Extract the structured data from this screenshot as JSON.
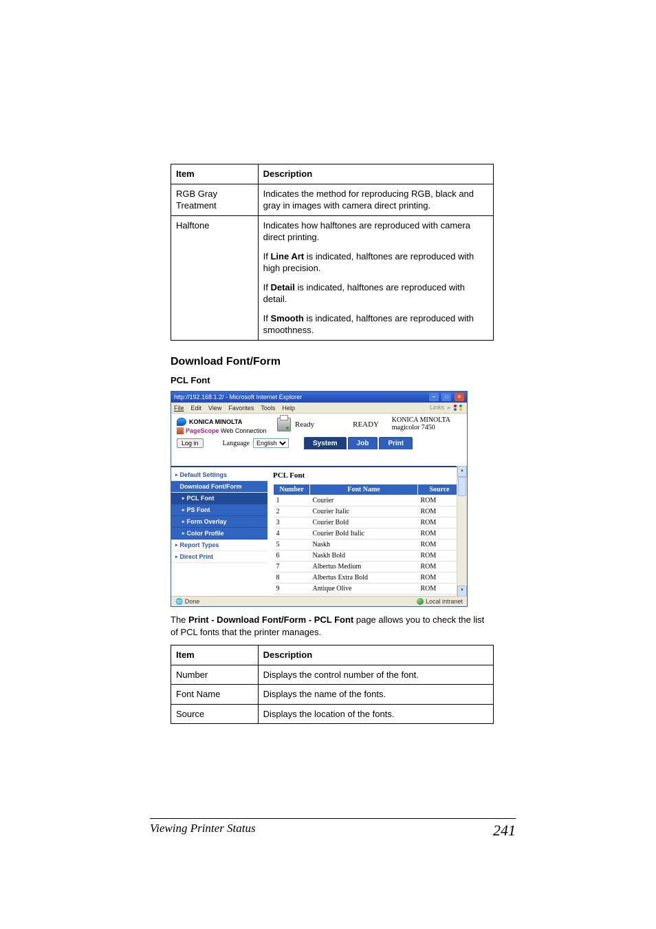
{
  "tables": {
    "top": {
      "head_item": "Item",
      "head_desc": "Description",
      "rows": [
        {
          "item": "RGB Gray Treatment",
          "desc": [
            "Indicates the method for reproducing RGB, black and gray in images with camera direct printing."
          ]
        },
        {
          "item": "Halftone",
          "desc": [
            "Indicates how halftones are reproduced with camera direct printing.",
            {
              "pre": "If ",
              "bold": "Line Art",
              "post": " is indicated, halftones are reproduced with high precision."
            },
            {
              "pre": "If ",
              "bold": "Detail",
              "post": " is indicated, halftones are reproduced with detail."
            },
            {
              "pre": "If ",
              "bold": "Smooth",
              "post": " is indicated, halftones are reproduced with smoothness."
            }
          ]
        }
      ]
    },
    "bottom": {
      "head_item": "Item",
      "head_desc": "Description",
      "rows": [
        {
          "item": "Number",
          "desc": "Displays the control number of the font."
        },
        {
          "item": "Font Name",
          "desc": "Displays the name of the fonts."
        },
        {
          "item": "Source",
          "desc": "Displays the location of the fonts."
        }
      ]
    }
  },
  "section": {
    "heading": "Download Font/Form",
    "sub": "PCL Font",
    "intro_pre": "The ",
    "intro_bold": "Print - Download Font/Form - PCL Font",
    "intro_post": " page allows you to check the list of PCL fonts that the printer manages."
  },
  "screenshot": {
    "title": "http://192.168.1.2/ - Microsoft Internet Explorer",
    "menu": [
      "File",
      "Edit",
      "View",
      "Favorites",
      "Tools",
      "Help"
    ],
    "links_label": "Links",
    "brand": "KONICA MINOLTA",
    "web_conn_pre": "PageScope",
    "web_conn": "Web Connection",
    "printer_ready": "Ready",
    "ready_big": "READY",
    "model1": "KONICA MINOLTA",
    "model2": "magicolor 7450",
    "login_btn": "Log in",
    "lang_label": "Language",
    "lang_value": "English",
    "tabs": [
      "System",
      "Job",
      "Print"
    ],
    "sidebar": {
      "default_settings": "Default Settings",
      "download": "Download Font/Form",
      "pcl": "PCL Font",
      "ps": "PS Font",
      "overlay": "Form Overlay",
      "color_profile": "Color Profile",
      "report": "Report Types",
      "direct": "Direct Print"
    },
    "pane_title": "PCL Font",
    "font_table": {
      "headers": [
        "Number",
        "Font Name",
        "Source"
      ],
      "rows": [
        [
          "1",
          "Courier",
          "ROM"
        ],
        [
          "2",
          "Courier Italic",
          "ROM"
        ],
        [
          "3",
          "Courier Bold",
          "ROM"
        ],
        [
          "4",
          "Courier Bold Italic",
          "ROM"
        ],
        [
          "5",
          "Naskh",
          "ROM"
        ],
        [
          "6",
          "Naskh Bold",
          "ROM"
        ],
        [
          "7",
          "Albertus Medium",
          "ROM"
        ],
        [
          "8",
          "Albertus Extra Bold",
          "ROM"
        ],
        [
          "9",
          "Antique Olive",
          "ROM"
        ]
      ]
    },
    "status_done": "Done",
    "status_zone": "Local intranet"
  },
  "footer": {
    "title": "Viewing Printer Status",
    "page": "241"
  }
}
